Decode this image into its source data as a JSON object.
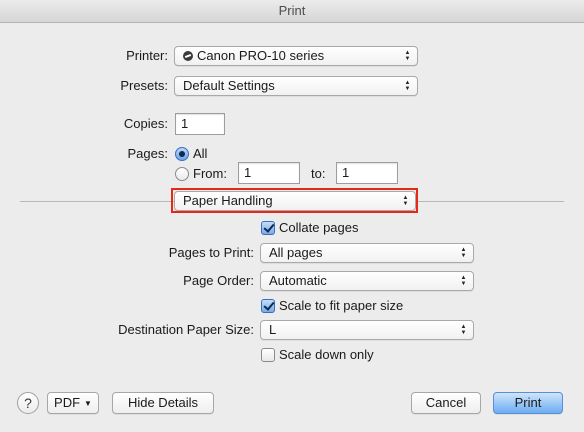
{
  "window": {
    "title": "Print"
  },
  "printer": {
    "label": "Printer:",
    "value": "Canon PRO-10 series",
    "icon": "printer-status-icon"
  },
  "presets": {
    "label": "Presets:",
    "value": "Default Settings"
  },
  "copies": {
    "label": "Copies:",
    "value": "1"
  },
  "pages": {
    "label": "Pages:",
    "all_label": "All",
    "from_label": "From:",
    "from_value": "1",
    "to_label": "to:",
    "to_value": "1",
    "selected": "All"
  },
  "section": {
    "value": "Paper Handling",
    "highlight_color": "#e8261a"
  },
  "collate": {
    "label": "Collate pages",
    "checked": true
  },
  "pages_to_print": {
    "label": "Pages to Print:",
    "value": "All pages"
  },
  "page_order": {
    "label": "Page Order:",
    "value": "Automatic"
  },
  "scale_to_fit": {
    "label": "Scale to fit paper size",
    "checked": true
  },
  "destination_paper_size": {
    "label": "Destination Paper Size:",
    "value": "L"
  },
  "scale_down": {
    "label": "Scale down only",
    "checked": false
  },
  "footer": {
    "help_label": "?",
    "pdf_label": "PDF",
    "hide_details_label": "Hide Details",
    "cancel_label": "Cancel",
    "print_label": "Print"
  },
  "colors": {
    "accent": "#6cacf2",
    "window_bg": "#ececec"
  }
}
